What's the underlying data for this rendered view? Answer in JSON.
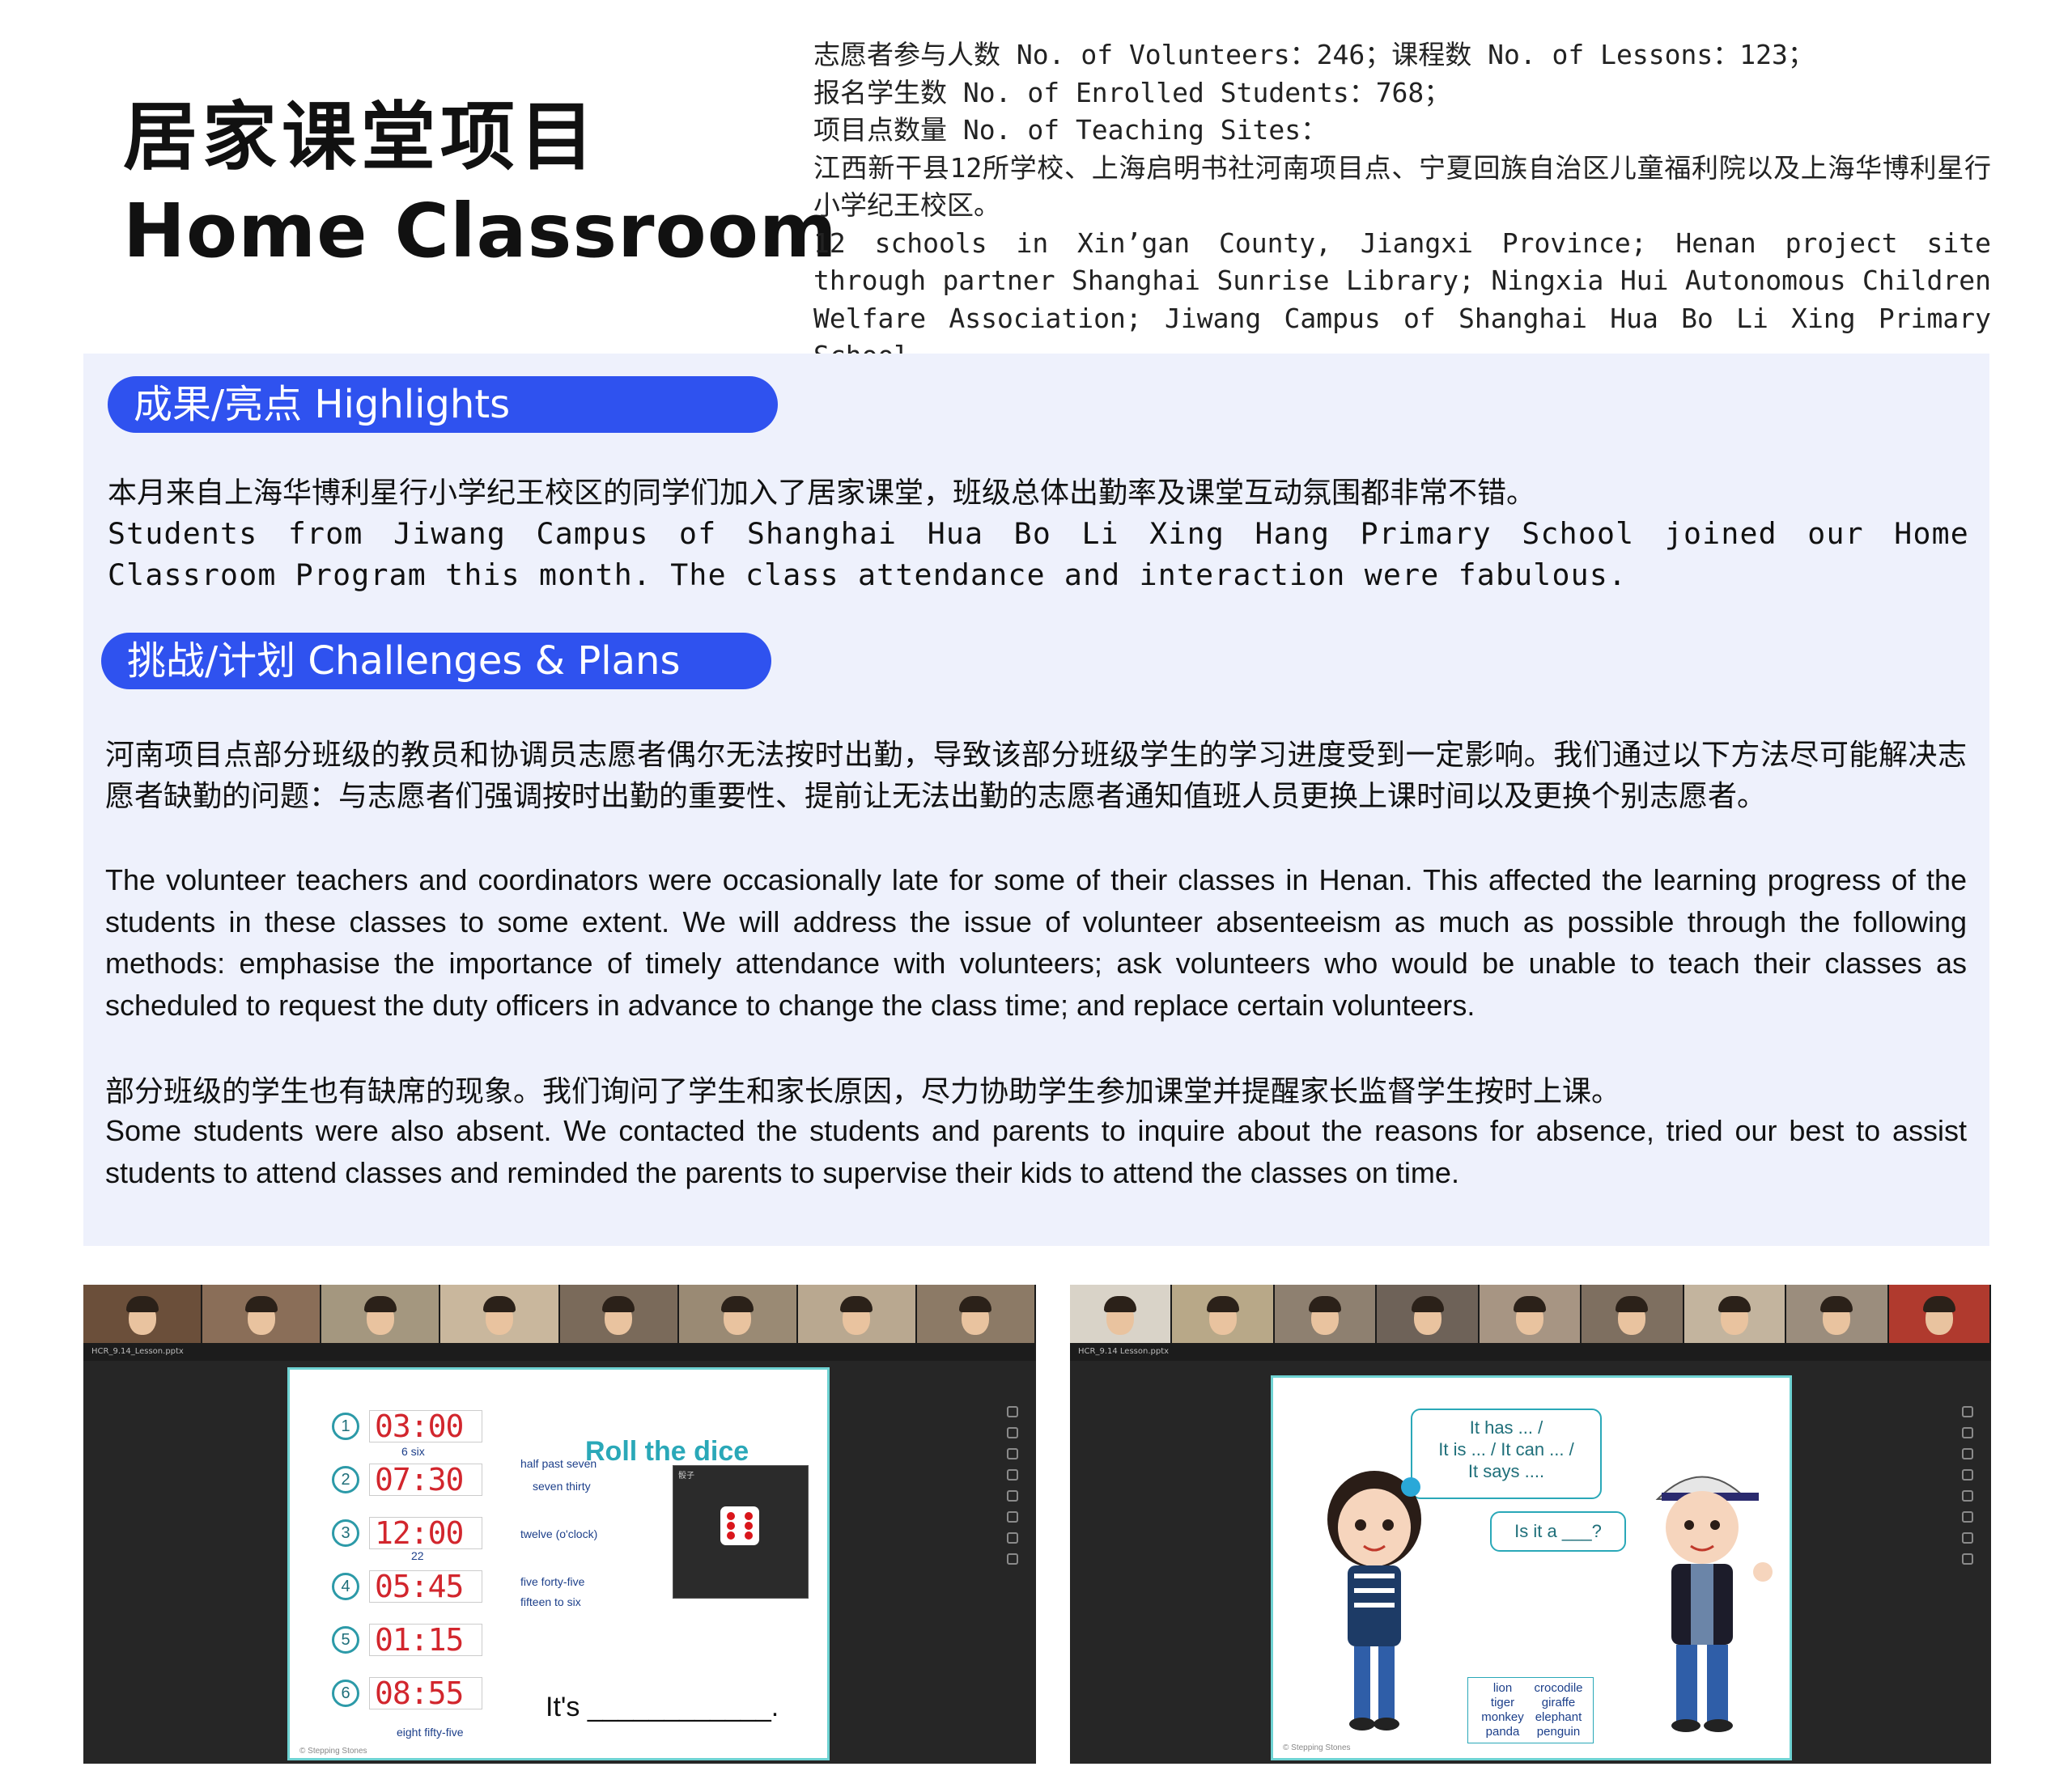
{
  "header": {
    "title_zh": "居家课堂项目",
    "title_en": "Home Classroom"
  },
  "stats": {
    "line1": "志愿者参与人数 No. of Volunteers：246；课程数 No. of Lessons：123；",
    "line2": "报名学生数 No. of Enrolled Students：768；",
    "line3": "项目点数量 No. of Teaching Sites：",
    "sites_zh": "江西新干县12所学校、上海启明书社河南项目点、宁夏回族自治区儿童福利院以及上海华博利星行小学纪王校区。",
    "sites_en": "12 schools in Xin’gan County, Jiangxi Province; Henan project site through partner Shanghai Sunrise Library; Ningxia Hui Autonomous Children Welfare Association; Jiwang Campus of Shanghai Hua Bo Li Xing Primary School."
  },
  "highlights": {
    "heading": "成果/亮点 Highlights",
    "text_zh": "本月来自上海华博利星行小学纪王校区的同学们加入了居家课堂，班级总体出勤率及课堂互动氛围都非常不错。",
    "text_en": "Students from Jiwang Campus of Shanghai Hua Bo Li Xing Hang Primary School joined our Home Classroom Program this month. The class attendance and interaction were fabulous."
  },
  "challenges": {
    "heading": "挑战/计划 Challenges & Plans",
    "p1_zh": "河南项目点部分班级的教员和协调员志愿者偶尔无法按时出勤，导致该部分班级学生的学习进度受到一定影响。我们通过以下方法尽可能解决志愿者缺勤的问题：与志愿者们强调按时出勤的重要性、提前让无法出勤的志愿者通知值班人员更换上课时间以及更换个别志愿者。",
    "p1_en": "The volunteer teachers and coordinators were occasionally late for some of their classes in Henan. This affected the learning progress of the students in these classes to some extent. We will address the issue of volunteer absenteeism as much as possible through the following methods: emphasise the importance of timely attendance with volunteers; ask volunteers who would be unable to teach their classes as scheduled to request the duty officers in advance to change the class time; and replace certain volunteers.",
    "p2_zh": "部分班级的学生也有缺席的现象。我们询问了学生和家长原因，尽力协助学生参加课堂并提醒家长监督学生按时上课。",
    "p2_en": "Some students were also absent. We contacted the students and parents to inquire about the reasons for absence, tried our best to assist students to attend classes and reminded the parents to supervise their kids to attend the classes on time."
  },
  "screenshot_left": {
    "file": "HCR_9.14_Lesson.pptx",
    "roll": "Roll the dice",
    "rows": [
      {
        "n": "1",
        "time": "03:00",
        "hint": ""
      },
      {
        "n": "2",
        "time": "07:30",
        "hint": "seven thirty"
      },
      {
        "n": "3",
        "time": "12:00",
        "hint": "twelve (o'clock)"
      },
      {
        "n": "4",
        "time": "05:45",
        "hint": "five forty-five"
      },
      {
        "n": "5",
        "time": "01:15",
        "hint": ""
      },
      {
        "n": "6",
        "time": "08:55",
        "hint": ""
      }
    ],
    "hint_six": "6 six",
    "hint_half": "half past seven",
    "hint_22": "22",
    "hint_fifteen": "fifteen to six",
    "hint_eight": "eight fifty-five",
    "its": "It's ____________.",
    "dice_title": "骰子",
    "brand": "© Stepping Stones"
  },
  "screenshot_right": {
    "file": "HCR_9.14 Lesson.pptx",
    "bubble1": [
      "It has ... /",
      "It is ... / It can ... /",
      "It says ...."
    ],
    "bubble2": "Is it a ___?",
    "words": [
      "lion",
      "crocodile",
      "tiger",
      "giraffe",
      "monkey",
      "elephant",
      "panda",
      "penguin"
    ],
    "brand": "© Stepping Stones"
  },
  "colors": {
    "accent": "#2f52ef",
    "panel_bg": "#eef1fc",
    "slide_border": "#6ed2d2",
    "clock_digits": "#d2262d"
  }
}
